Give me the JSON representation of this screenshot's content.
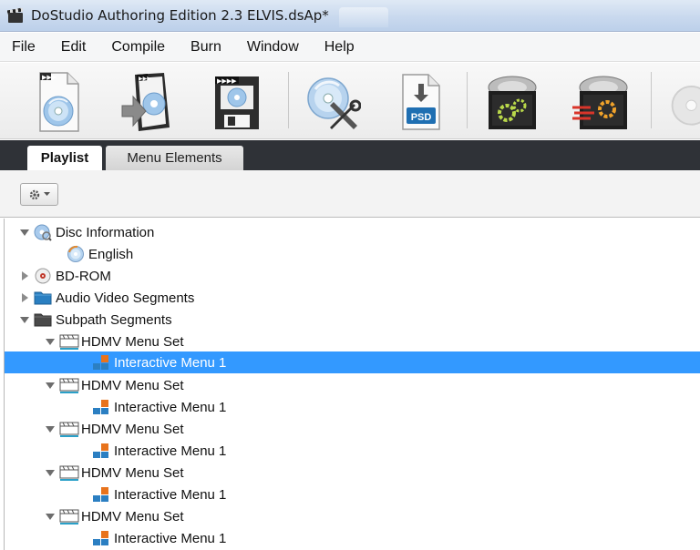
{
  "window": {
    "title": "DoStudio Authoring Edition 2.3 ELVIS.dsAp*"
  },
  "menu": [
    "File",
    "Edit",
    "Compile",
    "Burn",
    "Window",
    "Help"
  ],
  "toolbar": {
    "buttons": [
      {
        "name": "new-project-icon"
      },
      {
        "name": "open-project-icon"
      },
      {
        "name": "save-project-icon"
      },
      {
        "name": "disc-tools-icon"
      },
      {
        "name": "import-psd-icon",
        "badge": "PSD"
      },
      {
        "name": "compile-icon"
      },
      {
        "name": "burn-icon"
      }
    ]
  },
  "tabs": {
    "playlist": "Playlist",
    "menu_elements": "Menu Elements"
  },
  "tree": {
    "disc_information": "Disc Information",
    "english": "English",
    "bd_rom": "BD-ROM",
    "av_segments": "Audio Video Segments",
    "subpath_segments": "Subpath Segments",
    "menu_sets": [
      {
        "label": "HDMV Menu Set",
        "child": "Interactive Menu 1"
      },
      {
        "label": "HDMV Menu Set",
        "child": "Interactive Menu 1"
      },
      {
        "label": "HDMV Menu Set",
        "child": "Interactive Menu 1"
      },
      {
        "label": "HDMV Menu Set",
        "child": "Interactive Menu 1"
      },
      {
        "label": "HDMV Menu Set",
        "child": "Interactive Menu 1"
      }
    ]
  },
  "colors": {
    "selection": "#3399ff",
    "tab_strip": "#2f3237"
  }
}
